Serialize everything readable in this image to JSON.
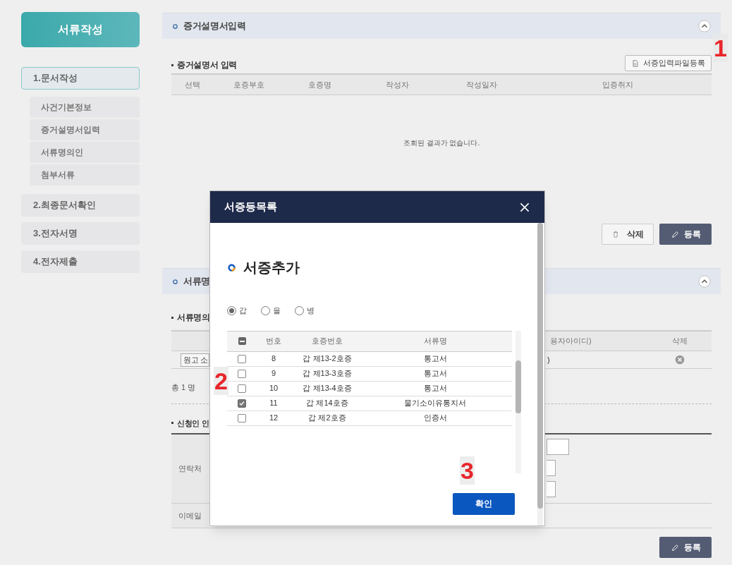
{
  "sidebar": {
    "title": "서류작성",
    "items": [
      {
        "label": "1.문서작성",
        "selected": true,
        "children": [
          {
            "label": "사건기본정보"
          },
          {
            "label": "증거설명서입력"
          },
          {
            "label": "서류명의인"
          },
          {
            "label": "첨부서류"
          }
        ]
      },
      {
        "label": "2.최종문서확인",
        "selected": false
      },
      {
        "label": "3.전자서명",
        "selected": false
      },
      {
        "label": "4.전자제출",
        "selected": false
      }
    ]
  },
  "evidence_section": {
    "title": "증거설명서입력",
    "subtitle": "증거설명서 입력",
    "file_button": "서증입력파일등록",
    "columns": [
      "선택",
      "호증부호",
      "호증명",
      "작성자",
      "작성일자",
      "입증취지"
    ],
    "empty_message": "조회된 결과가 없습니다.",
    "delete_button": "삭제",
    "register_button": "등록"
  },
  "name_section": {
    "title": "서류명",
    "subtitle": "서류명의",
    "columns": [
      "용자아이디)",
      "삭제"
    ],
    "row": {
      "party_button": "원고 소",
      "column_2": ")"
    },
    "total": "총 1 명",
    "applicant_subtitle": "신청인 인",
    "contact_label": "연락처",
    "email_label": "이메일",
    "register_button": "등록"
  },
  "modal": {
    "title": "서증등목록",
    "heading": "서증추가",
    "radios": [
      {
        "label": "갑",
        "selected": true
      },
      {
        "label": "을",
        "selected": false
      },
      {
        "label": "병",
        "selected": false
      }
    ],
    "header_checkbox": {
      "mixed": true
    },
    "columns": [
      "번호",
      "호증번호",
      "서류명"
    ],
    "rows": [
      {
        "checked": false,
        "number": "8",
        "evidence_no": "갑 제13-2호증",
        "document": "통고서"
      },
      {
        "checked": false,
        "number": "9",
        "evidence_no": "갑 제13-3호증",
        "document": "통고서"
      },
      {
        "checked": false,
        "number": "10",
        "evidence_no": "갑 제13-4호증",
        "document": "통고서"
      },
      {
        "checked": true,
        "number": "11",
        "evidence_no": "갑 제14호증",
        "document": "물기소이유통지서"
      },
      {
        "checked": false,
        "number": "12",
        "evidence_no": "갑 제2호증",
        "document": "인증서"
      }
    ],
    "confirm_button": "확인"
  },
  "step_markers": [
    "1",
    "2",
    "3"
  ]
}
